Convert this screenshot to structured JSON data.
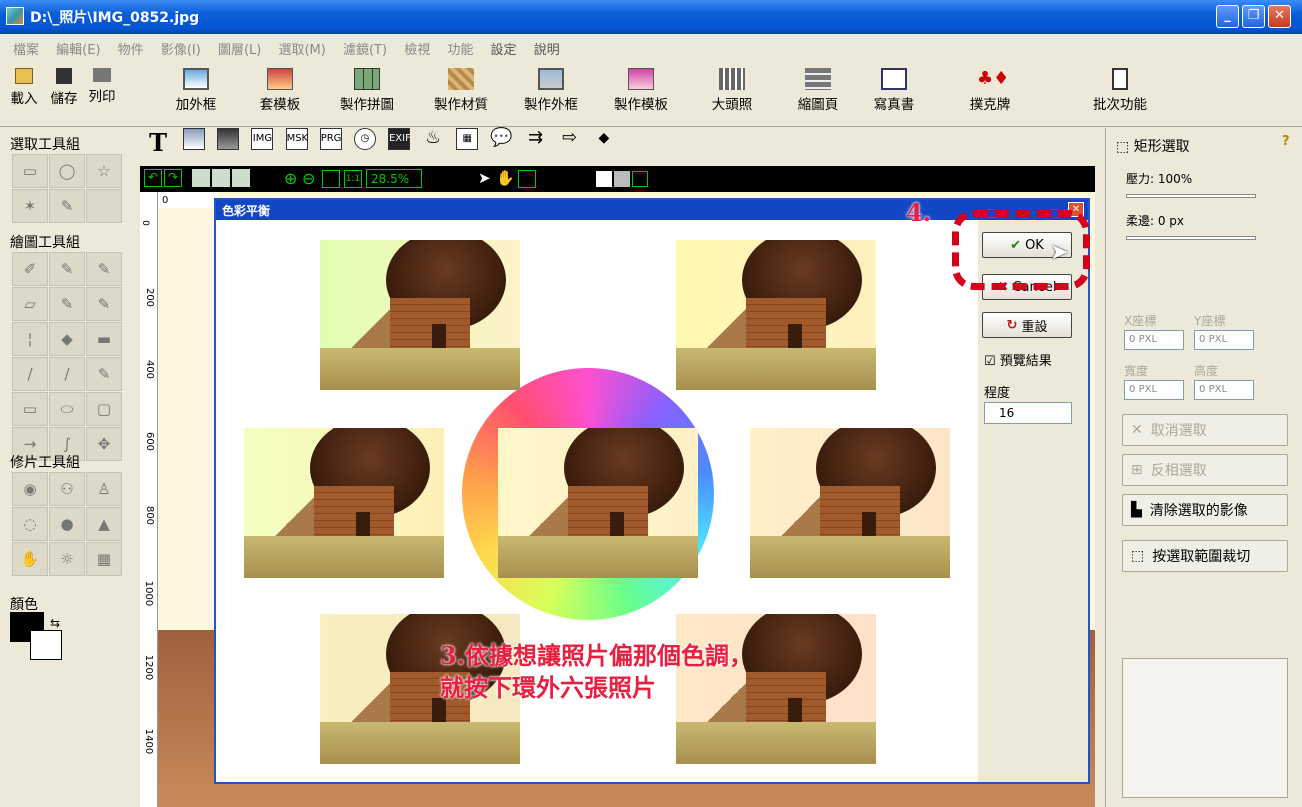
{
  "window": {
    "title": "D:\\_照片\\IMG_0852.jpg"
  },
  "menu": [
    {
      "label": "檔案"
    },
    {
      "label": "編輯(E)"
    },
    {
      "label": "物件"
    },
    {
      "label": "影像(I)"
    },
    {
      "label": "圖層(L)"
    },
    {
      "label": "選取(M)"
    },
    {
      "label": "濾鏡(T)"
    },
    {
      "label": "檢視"
    },
    {
      "label": "功能"
    },
    {
      "label": "設定"
    },
    {
      "label": "說明"
    }
  ],
  "toolbar": {
    "open": "載入",
    "save": "儲存",
    "print": "列印",
    "frame": "加外框",
    "template": "套模板",
    "collage": "製作拼圖",
    "texture": "製作材質",
    "make_frame": "製作外框",
    "make_template": "製作模板",
    "id_photo": "大頭照",
    "thumbnail": "縮圖頁",
    "photobook": "寫真書",
    "poker": "撲克牌",
    "batch": "批次功能"
  },
  "left_panel": {
    "select_group": "選取工具組",
    "draw_group": "繪圖工具組",
    "retouch_group": "修片工具組",
    "color_label": "顏色"
  },
  "canvas": {
    "zoom": "28.5%",
    "ruler_v": [
      "0",
      "200",
      "400",
      "600",
      "800",
      "1000",
      "1200",
      "1400"
    ],
    "ruler_h": "0"
  },
  "dialog": {
    "title": "色彩平衡",
    "ok": "OK",
    "cancel": "Cancel",
    "reset": "重設",
    "preview": "預覽結果",
    "degree_label": "程度",
    "degree_value": "16"
  },
  "right_panel": {
    "tool_title": "矩形選取",
    "pressure": "壓力: 100%",
    "feather": "柔邊: 0 px",
    "x_label": "X座標",
    "y_label": "Y座標",
    "w_label": "寬度",
    "h_label": "高度",
    "coord_value": "0",
    "unit": "PXL",
    "cancel_select": "取消選取",
    "invert_select": "反相選取",
    "clear_select": "清除選取的影像",
    "crop_select": "按選取範圍裁切"
  },
  "annotations": {
    "step4": "4.",
    "step3_line1": "3.依據想讓照片偏那個色調，",
    "step3_line2": "就按下環外六張照片"
  },
  "colors": {
    "accent_red": "#e82040",
    "title_blue": "#0a5fd8",
    "dialog_blue": "#1346c5"
  }
}
